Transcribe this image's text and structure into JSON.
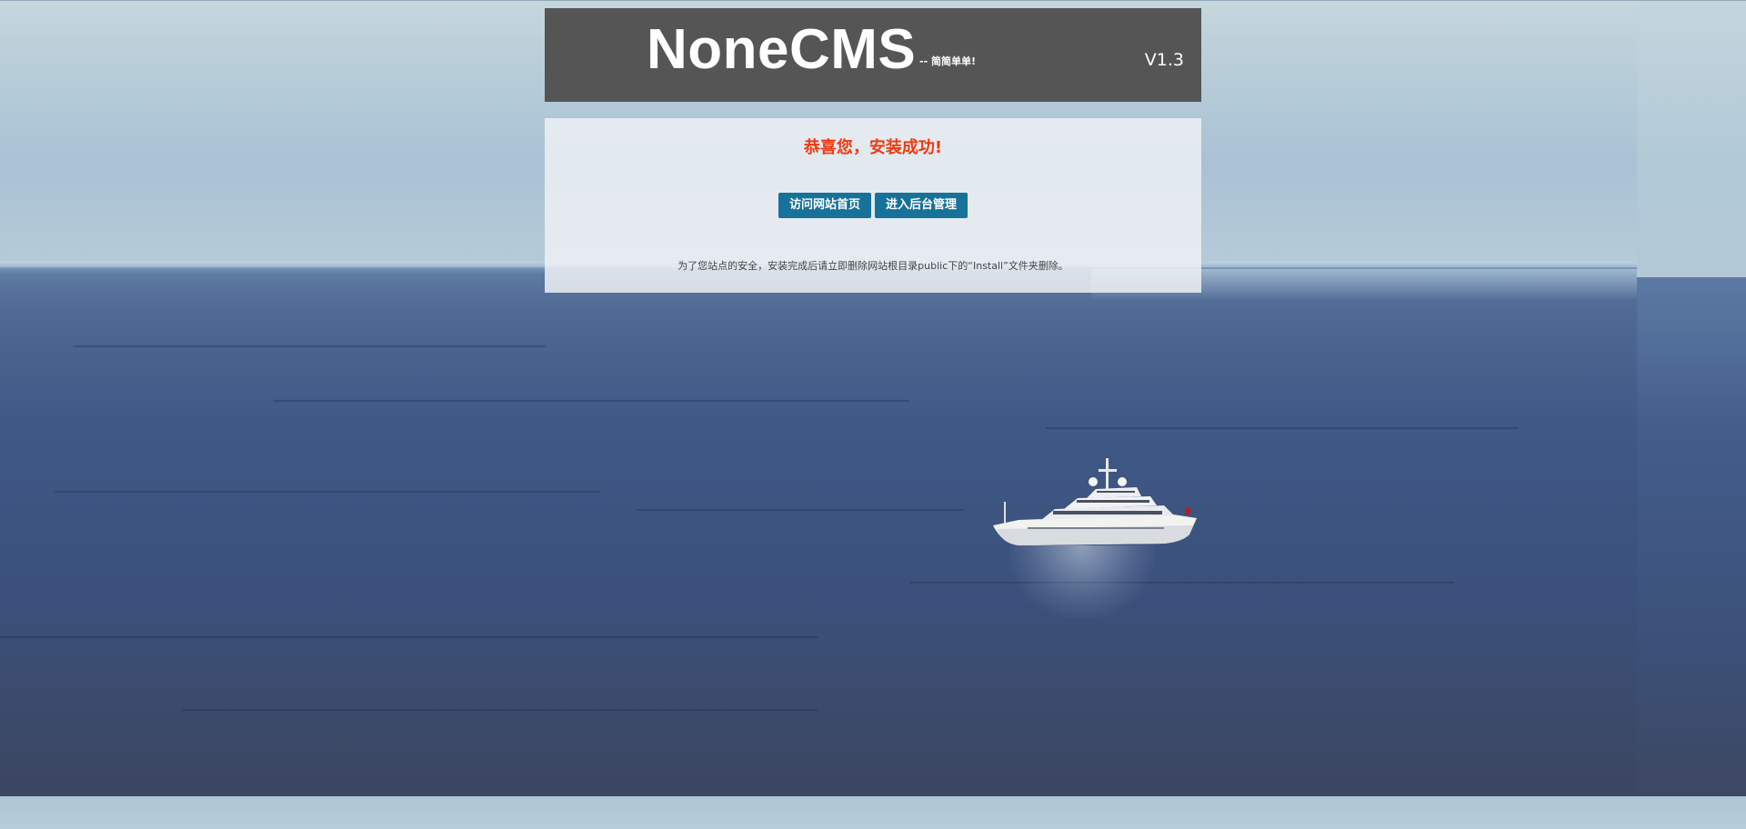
{
  "header": {
    "brand": "NoneCMS",
    "slogan": "-- 简简单单!",
    "version": "V1.3"
  },
  "install": {
    "success_message": "恭喜您，安装成功!",
    "buttons": {
      "visit_home": "访问网站首页",
      "enter_admin": "进入后台管理"
    },
    "security_note": "为了您站点的安全，安装完成后请立即删除网站根目录public下的“Install”文件夹删除。"
  },
  "colors": {
    "header_bg": "#555555",
    "success_text": "#ef3a12",
    "button_bg": "#17729a"
  }
}
